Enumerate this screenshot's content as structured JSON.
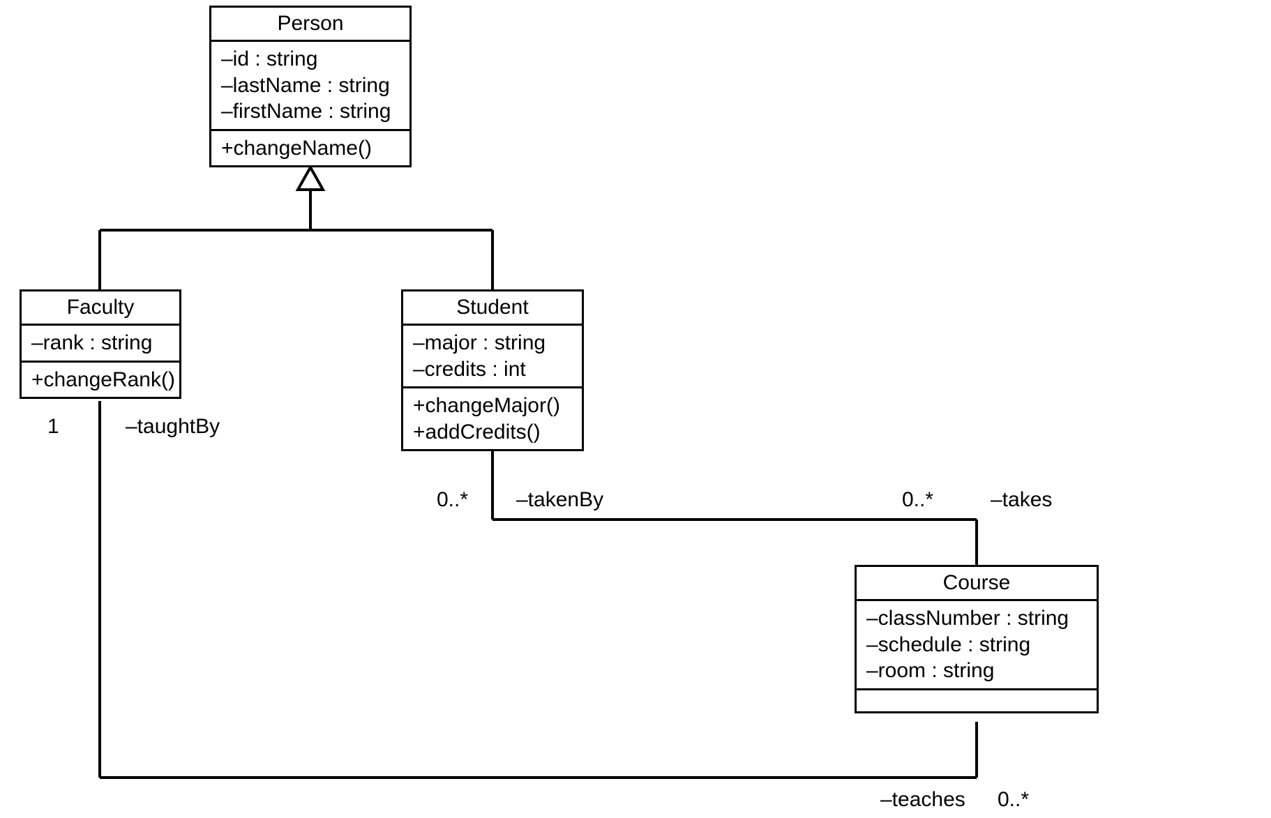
{
  "classes": {
    "person": {
      "name": "Person",
      "attrs": [
        "–id : string",
        "–lastName : string",
        "–firstName : string"
      ],
      "ops": [
        "+changeName()"
      ]
    },
    "faculty": {
      "name": "Faculty",
      "attrs": [
        "–rank : string"
      ],
      "ops": [
        "+changeRank()"
      ]
    },
    "student": {
      "name": "Student",
      "attrs": [
        "–major : string",
        "–credits : int"
      ],
      "ops": [
        "+changeMajor()",
        "+addCredits()"
      ]
    },
    "course": {
      "name": "Course",
      "attrs": [
        "–classNumber : string",
        "–schedule : string",
        "–room : string"
      ],
      "ops": []
    }
  },
  "labels": {
    "faculty_one": "1",
    "taughtBy": "–taughtBy",
    "takenBy_mult": "0..*",
    "takenBy": "–takenBy",
    "takes_mult": "0..*",
    "takes": "–takes",
    "teaches": "–teaches",
    "teaches_mult": "0..*"
  }
}
